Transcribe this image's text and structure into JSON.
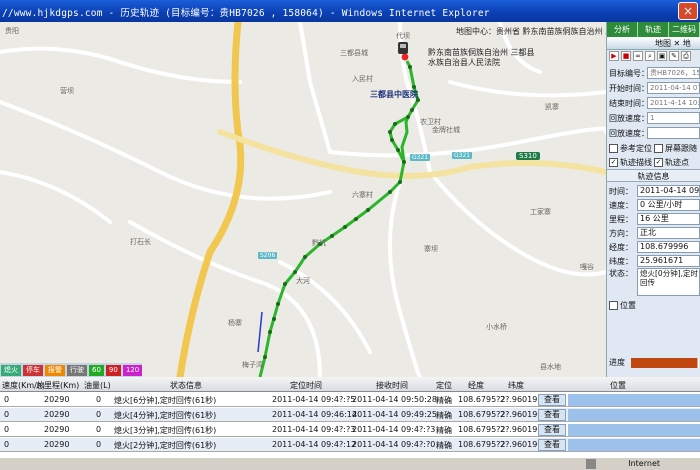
{
  "window": {
    "title": "//www.hjkdgps.com - 历史轨迹 (目标编号：贵HB7026 , 158064) - Windows Internet Explorer",
    "close_label": "×"
  },
  "map": {
    "labels": {
      "top_left": "贵阳",
      "left_mid": "营坝",
      "left_lower": "打石长",
      "bottom_mid1": "杨寨",
      "bottom_mid2": "梅子湾",
      "center_top": "三都县城",
      "center_top2": "代坝",
      "hospital": "三都县中医院",
      "road1": "入民村",
      "road2": "农卫村",
      "road3": "金牌社城",
      "middle": "六寨村",
      "middle2": "黔坑",
      "lower_mid": "大河",
      "lower_mid2": "寨坝",
      "right_village": "工家寨",
      "bottom_right": "小水桥",
      "upper_right": "黔东南苗族侗族自治州 三都县",
      "upper_right2": "水族自治县人民法院",
      "top_bar": "地图中心：贵州省 黔东南苗族侗族自治州 三都县",
      "kaihao": "凯寨",
      "far_right": "嘎谷",
      "bottom_far_right": "县水地"
    },
    "road_badge": "S310",
    "scale_badges": [
      "G321",
      "G321",
      "S206"
    ]
  },
  "right_panel": {
    "tabs": [
      "分析",
      "轨迹",
      "二维码"
    ],
    "header": "地图 ✕ 地",
    "fields": [
      {
        "label": "目标编号：",
        "value": "贵HB7026，158064"
      },
      {
        "label": "开始时间：",
        "value": "2011-04-14 07:00"
      },
      {
        "label": "结束时间：",
        "value": "2011-4-14 10:00"
      },
      {
        "label": "回放速度：",
        "value": "1"
      },
      {
        "label": "回放速度：",
        "value": ""
      }
    ],
    "checks": [
      {
        "label": "参考定位",
        "checked": false
      },
      {
        "label": "屏幕跟随",
        "checked": false
      },
      {
        "label": "轨迹描线",
        "checked": true
      },
      {
        "label": "轨迹点",
        "checked": true
      }
    ],
    "section_title": "轨迹信息",
    "info": [
      {
        "label": "时间：",
        "value": "2011-04-14 09:47"
      },
      {
        "label": "速度：",
        "value": "0 公里/小时"
      },
      {
        "label": "里程：",
        "value": "16 公里"
      },
      {
        "label": "方向：",
        "value": "正北"
      },
      {
        "label": "经度：",
        "value": "108.679996"
      },
      {
        "label": "纬度：",
        "value": "25.961671"
      },
      {
        "label": "状态：",
        "value": "熄火[0分钟],定时回传"
      }
    ],
    "location_check": "位置",
    "progress_label": "进度",
    "progress_value": 0.98
  },
  "bottom": {
    "legend": [
      {
        "label": "熄火",
        "color": "#3a7"
      },
      {
        "label": "停车",
        "color": "#c33"
      },
      {
        "label": "报警",
        "color": "#e80"
      },
      {
        "label": "行驶",
        "color": "#777"
      },
      {
        "label": "60",
        "color": "#2a2"
      },
      {
        "label": "90",
        "color": "#c22"
      },
      {
        "label": "120",
        "color": "#c2c"
      }
    ],
    "columns": [
      "速度(Km/h)",
      "总里程(Km)",
      "油量(L)",
      "状态信息",
      "定位时间",
      "接收时间",
      "定位",
      "经度",
      "纬度",
      "位置"
    ],
    "rows": [
      {
        "speed": "0",
        "mileage": "20290",
        "oil": "0",
        "status": "熄火[6分钟],定时回传(61秒)",
        "gps_time": "2011-04-14 09:4?:?5",
        "recv_time": "2011-04-14 09:50:28",
        "pos": "精确",
        "lon": "108.6795?2",
        "lat": "2?.960190",
        "view": "查看"
      },
      {
        "speed": "0",
        "mileage": "20290",
        "oil": "0",
        "status": "熄火[4分钟],定时回传(61秒)",
        "gps_time": "2011-04-14 09:46:14",
        "recv_time": "2011-04-14 09:49:25",
        "pos": "精确",
        "lon": "108.6795?2",
        "lat": "2?.960190",
        "view": "查看"
      },
      {
        "speed": "0",
        "mileage": "20290",
        "oil": "0",
        "status": "熄火[3分钟],定时回传(61秒)",
        "gps_time": "2011-04-14 09:4?:?3",
        "recv_time": "2011-04-14 09:4?:?3",
        "pos": "精确",
        "lon": "108.6795?2",
        "lat": "2?.960190",
        "view": "查看"
      },
      {
        "speed": "0",
        "mileage": "20290",
        "oil": "0",
        "status": "熄火[2分钟],定时回传(61秒)",
        "gps_time": "2011-04-14 09:4?:12",
        "recv_time": "2011-04-14 09:4?:?0",
        "pos": "精确",
        "lon": "108.6795?2",
        "lat": "2?.960190",
        "view": "查看"
      }
    ]
  },
  "status": {
    "zone": "Internet"
  }
}
